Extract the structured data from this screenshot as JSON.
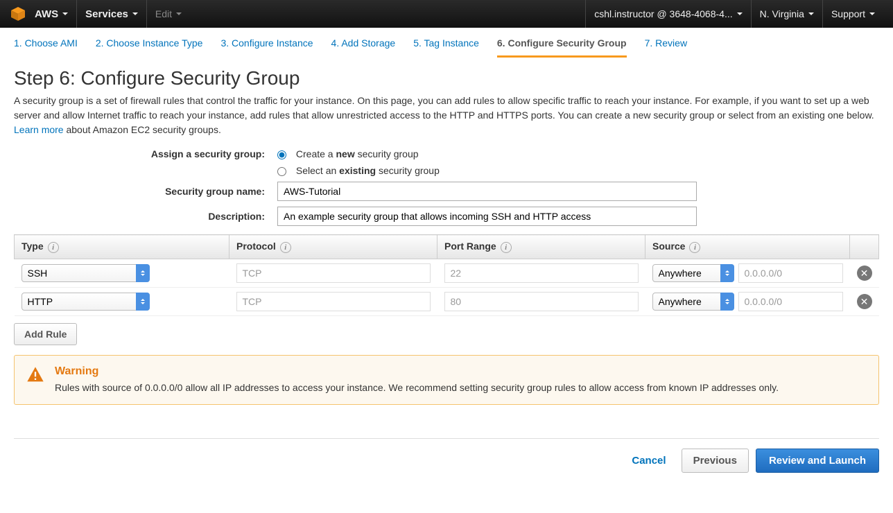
{
  "topnav": {
    "brand": "AWS",
    "services": "Services",
    "edit": "Edit",
    "account": "cshl.instructor @ 3648-4068-4...",
    "region": "N. Virginia",
    "support": "Support"
  },
  "steps": [
    {
      "label": "1. Choose AMI"
    },
    {
      "label": "2. Choose Instance Type"
    },
    {
      "label": "3. Configure Instance"
    },
    {
      "label": "4. Add Storage"
    },
    {
      "label": "5. Tag Instance"
    },
    {
      "label": "6. Configure Security Group"
    },
    {
      "label": "7. Review"
    }
  ],
  "active_step_index": 5,
  "page": {
    "heading": "Step 6: Configure Security Group",
    "intro_pre": "A security group is a set of firewall rules that control the traffic for your instance. On this page, you can add rules to allow specific traffic to reach your instance. For example, if you want to set up a web server and allow Internet traffic to reach your instance, add rules that allow unrestricted access to the HTTP and HTTPS ports. You can create a new security group or select from an existing one below. ",
    "learn_more": "Learn more",
    "intro_post": " about Amazon EC2 security groups."
  },
  "form": {
    "assign_label": "Assign a security group:",
    "radio_create_pre": "Create a ",
    "radio_create_bold": "new",
    "radio_create_post": " security group",
    "radio_existing_pre": "Select an ",
    "radio_existing_bold": "existing",
    "radio_existing_post": " security group",
    "selected_radio": "create",
    "name_label": "Security group name:",
    "name_value": "AWS-Tutorial",
    "desc_label": "Description:",
    "desc_value": "An example security group that allows incoming SSH and HTTP access"
  },
  "table": {
    "headers": {
      "type": "Type",
      "protocol": "Protocol",
      "port": "Port Range",
      "source": "Source"
    },
    "rows": [
      {
        "type": "SSH",
        "protocol": "TCP",
        "port": "22",
        "source_mode": "Anywhere",
        "source_cidr": "0.0.0.0/0"
      },
      {
        "type": "HTTP",
        "protocol": "TCP",
        "port": "80",
        "source_mode": "Anywhere",
        "source_cidr": "0.0.0.0/0"
      }
    ],
    "add_rule": "Add Rule"
  },
  "warning": {
    "title": "Warning",
    "text": "Rules with source of 0.0.0.0/0 allow all IP addresses to access your instance. We recommend setting security group rules to allow access from known IP addresses only."
  },
  "footer": {
    "cancel": "Cancel",
    "previous": "Previous",
    "review": "Review and Launch"
  }
}
